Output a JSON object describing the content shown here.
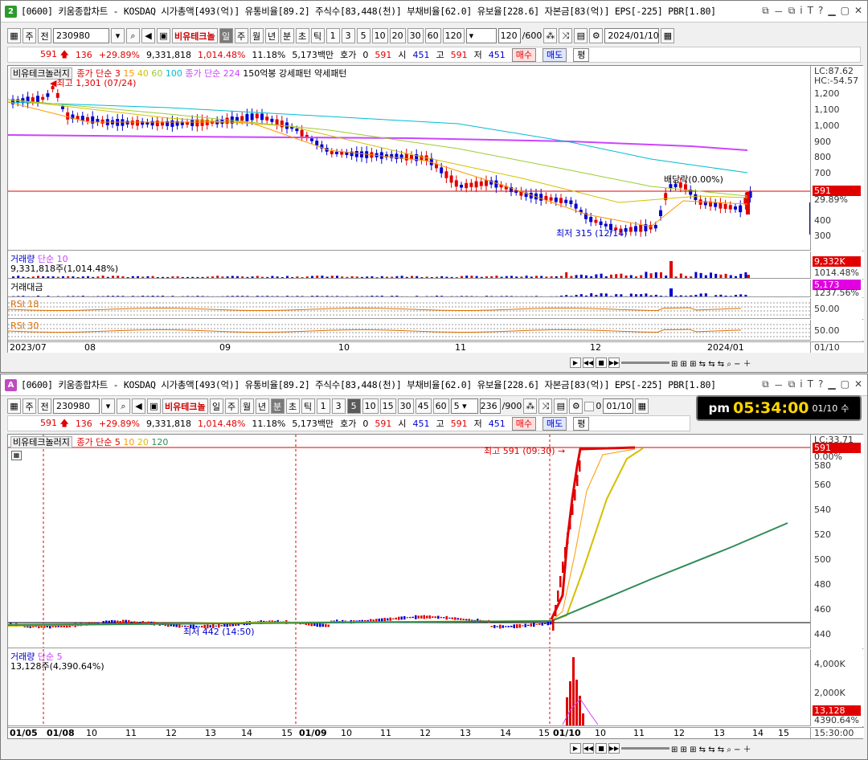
{
  "windows": [
    {
      "badge": "2",
      "badge_color": "#2c9a2c",
      "title": "[0600] 키움종합차트 - KOSDAQ 시가총액[493(억)] 유통비율[89.2] 주식수[83,448(천)] 부채비율[62.0] 유보율[228.6] 자본금[83(억)] EPS[-225] PBR[1.80]",
      "toolbar": {
        "b1": "주",
        "b2": "전",
        "code": "230980",
        "name": "비유테크놀",
        "periods": [
          "일",
          "주",
          "월",
          "년",
          "분",
          "초",
          "틱"
        ],
        "selected_period": "일",
        "nums": [
          "1",
          "3",
          "5",
          "10",
          "20",
          "30",
          "60",
          "120"
        ],
        "count": "120",
        "total": "/600",
        "date": "2024/01/10"
      },
      "quote": {
        "price": "591",
        "change": "136",
        "pct": "+29.89%",
        "volume": "9,331,818",
        "vol_pct": "1,014.48%",
        "turnover": "11.18%",
        "amount": "5,173백만",
        "hoga": "호가",
        "hoga_v": "0",
        "p2": "591",
        "open_l": "시",
        "open": "451",
        "high_l": "고",
        "high": "591",
        "low_l": "저",
        "low": "451",
        "buy": "매수",
        "sell": "매도",
        "avg": "평"
      },
      "panes": {
        "main": {
          "tab": "비유테크놀러지",
          "ma_label": "종가 단순",
          "ma": [
            "3",
            "15",
            "40",
            "60",
            "100"
          ],
          "ma2": "종가 단순 224",
          "extra": "150억봉 강세패턴  약세패턴",
          "high_note": "최고 1,301 (07/24)",
          "low_note": "최저 315 (12/14)",
          "div_note": "배당락(0.00%)",
          "lc": "LC:87.62",
          "hc": "HC:-54.57",
          "tag_price": "591",
          "tag_pct": "29.89%",
          "ticks": [
            "1,200",
            "1,100",
            "1,000",
            "900",
            "800",
            "700",
            "600",
            "500",
            "400",
            "300"
          ]
        },
        "vol": {
          "label": "거래량",
          "ma": "단순 10",
          "value": "9,331,818주(1,014.48%)",
          "tag1": "9,332K",
          "tag2": "1014.48%"
        },
        "amt": {
          "label": "거래대금",
          "tag1": "5,173",
          "tag2": "1237.56%"
        },
        "rsi1": {
          "label": "RSI 18",
          "tick": "50.00"
        },
        "rsi2": {
          "label": "RSI 30",
          "tick": "50.00"
        }
      },
      "xaxis": [
        "2023/07",
        "08",
        "09",
        "10",
        "11",
        "12",
        "2024/01"
      ],
      "xaxis_right": "01/10"
    },
    {
      "badge": "A",
      "badge_color": "#c04ac0",
      "title": "[0600] 키움종합차트 - KOSDAQ 시가총액[493(억)] 유통비율[89.2] 주식수[83,448(천)] 부채비율[62.0] 유보율[228.6] 자본금[83(억)] EPS[-225] PBR[1.80]",
      "toolbar": {
        "b1": "주",
        "b2": "전",
        "code": "230980",
        "name": "비유테크놀",
        "periods": [
          "일",
          "주",
          "월",
          "년",
          "분",
          "초",
          "틱"
        ],
        "selected_period": "분",
        "nums": [
          "1",
          "3",
          "5",
          "10",
          "15",
          "30",
          "45",
          "60"
        ],
        "sel_num": "5",
        "combo": "5",
        "count": "236",
        "total": "/900",
        "chk": "0",
        "date": "01/10"
      },
      "quote": {
        "price": "591",
        "change": "136",
        "pct": "+29.89%",
        "volume": "9,331,818",
        "vol_pct": "1,014.48%",
        "turnover": "11.18%",
        "amount": "5,173백만",
        "hoga": "호가",
        "hoga_v": "0",
        "p2": "591",
        "open_l": "시",
        "open": "451",
        "high_l": "고",
        "high": "591",
        "low_l": "저",
        "low": "451",
        "buy": "매수",
        "sell": "매도",
        "avg": "평"
      },
      "panes": {
        "main": {
          "tab": "비유테크놀러지",
          "ma_label": "종가 단순",
          "ma": [
            "5",
            "10",
            "20",
            "120"
          ],
          "high_note": "최고 591 (09:30)",
          "low_note": "최저 442 (14:50)",
          "lc": "LC:33.71",
          "tag_price": "591",
          "tag_pct": "0.00%",
          "ticks": [
            "580",
            "560",
            "540",
            "520",
            "500",
            "480",
            "460",
            "440"
          ]
        },
        "vol": {
          "label": "거래량",
          "ma": "단순 5",
          "value": "13,128주(4,390.64%)",
          "ticks": [
            "4,000K",
            "2,000K"
          ],
          "tag1": "13,128",
          "tag2": "4390.64%"
        }
      },
      "xaxis": [
        "01/05",
        "01/08",
        "10",
        "11",
        "12",
        "13",
        "14",
        "15",
        "01/09",
        "10",
        "11",
        "12",
        "13",
        "14",
        "15",
        "01/10",
        "10",
        "11",
        "12",
        "13",
        "14",
        "15"
      ],
      "xaxis_right": "15:30:00"
    }
  ],
  "clock": {
    "ampm": "pm",
    "time": "05:34:00",
    "date": "01/10",
    "day": "수"
  },
  "colors": {
    "up": "#e00000",
    "down": "#0000d0",
    "ma1": "#e00000",
    "ma2": "#ff9900",
    "ma3": "#d4c000",
    "ma4": "#9acd32",
    "ma5": "#00bcd4",
    "ma224": "#cc44ff",
    "ma120": "#2e8b57"
  }
}
